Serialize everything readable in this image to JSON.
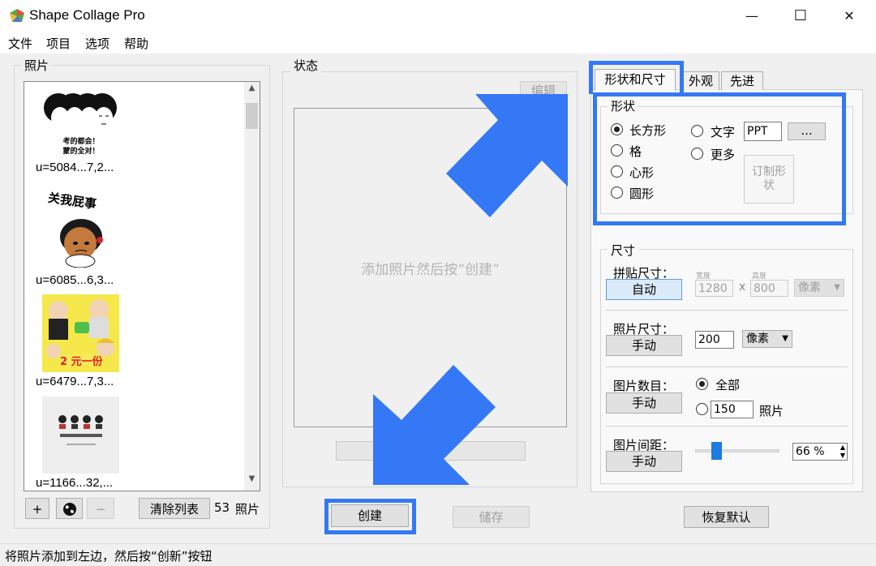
{
  "window": {
    "title": "Shape Collage Pro",
    "minimize_glyph": "—",
    "maximize_glyph": "☐",
    "close_glyph": "✕"
  },
  "menu": [
    "文件",
    "项目",
    "选项",
    "帮助"
  ],
  "photos_panel": {
    "title": "照片",
    "items": [
      {
        "label": "u=5084...7,2...",
        "caption_line1": "考的都会！",
        "caption_line2": "蒙的全对！"
      },
      {
        "label": "u=6085...6,3...",
        "caption_line1": "关我屁事"
      },
      {
        "label": "u=6479...7,3...",
        "caption_line1": "2 元一份"
      },
      {
        "label": "u=1166...32,..."
      }
    ],
    "add_label": "+",
    "remove_label": "−",
    "clear_label": "清除列表",
    "count": "53",
    "count_unit": "照片"
  },
  "status_panel": {
    "title": "状态",
    "edit_label": "编辑",
    "placeholder": "添加照片然后按“创建”"
  },
  "actions": {
    "create_label": "创建",
    "save_label": "储存",
    "reset_label": "恢复默认"
  },
  "tabs": [
    "形状和尺寸",
    "外观",
    "先进"
  ],
  "shape": {
    "title": "形状",
    "options": [
      "长方形",
      "格",
      "心形",
      "圆形"
    ],
    "text_option": "文字",
    "text_value": "PPT",
    "more_option": "更多",
    "browse_label": "...",
    "custom_label": "订制形状",
    "selected": "长方形"
  },
  "size": {
    "title": "尺寸",
    "collage_size_label": "拼贴尺寸：",
    "collage_mode": "自动",
    "width_caption": "宽度",
    "height_caption": "高度",
    "width_value": "1280",
    "times": "x",
    "height_value": "800",
    "unit_disabled": "像素",
    "photo_size_label": "照片尺寸：",
    "photo_mode": "手动",
    "photo_size_value": "200",
    "photo_unit": "像素",
    "count_label": "图片数目：",
    "count_mode": "手动",
    "count_all": "全部",
    "count_value": "150",
    "count_unit": "照片",
    "spacing_label": "图片间距：",
    "spacing_mode": "手动",
    "spacing_value": "66 %",
    "spacing_fraction": 0.22
  },
  "status_bar": "将照片添加到左边，然后按“创新”按钮",
  "colors": {
    "highlight": "#3478f6",
    "arrow": "#3478f6"
  }
}
